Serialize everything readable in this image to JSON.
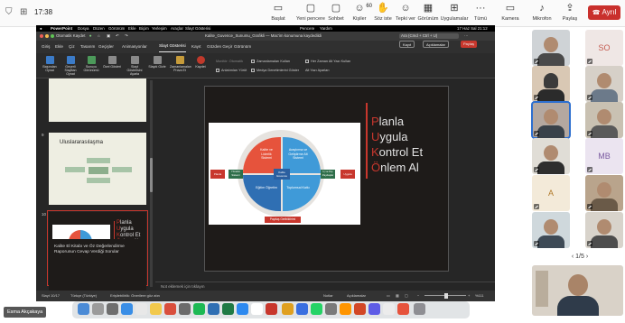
{
  "meeting": {
    "clock": "17:38",
    "toolbar": [
      {
        "label": "Başlat",
        "icon": "video-camera-icon"
      },
      {
        "label": "Yeni pencere",
        "icon": "new-window-icon"
      },
      {
        "label": "Sohbet",
        "icon": "chat-icon"
      },
      {
        "label": "Kişiler",
        "icon": "people-icon",
        "count": "60"
      },
      {
        "label": "Söz iste",
        "icon": "raise-hand-icon"
      },
      {
        "label": "Tepki ver",
        "icon": "react-icon"
      },
      {
        "label": "Görünüm",
        "icon": "view-icon"
      },
      {
        "label": "Uygulamalar",
        "icon": "apps-icon"
      },
      {
        "label": "Tümü",
        "icon": "more-icon"
      },
      {
        "label": "Kamera",
        "icon": "camera-icon"
      },
      {
        "label": "Mikrofon",
        "icon": "microphone-icon"
      },
      {
        "label": "Paylaş",
        "icon": "share-icon"
      }
    ],
    "leave_label": "Ayrıl",
    "pager": "1/5",
    "presenter_name": "Esma Akçakaya",
    "participants": [
      {
        "kind": "video"
      },
      {
        "kind": "initials",
        "initials": "SO"
      },
      {
        "kind": "video"
      },
      {
        "kind": "video"
      },
      {
        "kind": "video",
        "active": true
      },
      {
        "kind": "video"
      },
      {
        "kind": "video"
      },
      {
        "kind": "initials",
        "initials": "MB"
      },
      {
        "kind": "initials",
        "initials": "A"
      },
      {
        "kind": "video"
      },
      {
        "kind": "video"
      },
      {
        "kind": "video"
      }
    ]
  },
  "mac_menu": {
    "app": "PowerPoint",
    "items": [
      "Dosya",
      "Düzen",
      "Görünüm",
      "Ekle",
      "Biçim",
      "Yerleşim",
      "Araçlar",
      "Slayt Gösterisi",
      "Pencere",
      "Yardım"
    ],
    "clock": "17 Haz Sal 21:12"
  },
  "ppt": {
    "autosave": "Otomatik Kaydet",
    "doc_title": "Kalite_Guvence_Sunumu_Grafikli — Mac'im konumuna kaydedildi",
    "search": "Ara (Cmd + Ctrl + U)",
    "tabs": [
      "Giriş",
      "Ekle",
      "Çiz",
      "Tasarım",
      "Geçişler",
      "Animasyonlar",
      "Slayt Gösterisi",
      "Kayıt",
      "Gözden Geçir",
      "Görünüm"
    ],
    "active_tab": "Slayt Gösterisi",
    "btn_record": "Kayıt",
    "btn_comments": "Açıklamalar",
    "btn_share": "Paylaş",
    "ribbon": [
      {
        "label": "Başından Oynat",
        "color": "#3b7bc8"
      },
      {
        "label": "Geçerli Slayttan Oynat",
        "color": "#3b7bc8"
      },
      {
        "label": "Sunucu Görünümü",
        "color": "#4c9a5a"
      },
      {
        "label": "Özel Gösteri",
        "color": "#8a8a8a"
      },
      {
        "label": "Slayt Gösterisini Ayarla",
        "color": "#8a8a8a"
      },
      {
        "label": "Slaydı Gizle",
        "color": "#8a8a8a"
      },
      {
        "label": "Zamanlamaları Prova Et",
        "color": "#c69b3a"
      },
      {
        "label": "Kaydet",
        "color": "#c0392b"
      }
    ],
    "ribbon_options": [
      {
        "label": "Monitör: Otomatik",
        "checked": false
      },
      {
        "label": "Zamanlamaları Kullan",
        "checked": true
      },
      {
        "label": "Anlatımları Yürüt",
        "checked": true
      },
      {
        "label": "Medya Denetimlerini Göster",
        "checked": true
      },
      {
        "label": "Her Zaman Alt Yazı Kullan",
        "checked": false
      },
      {
        "label": "Alt Yazı Ayarları",
        "checked": false
      }
    ],
    "thumbs": [
      {
        "num": "8",
        "text": ""
      },
      {
        "num": "9",
        "text": "Uluslararasılaşma"
      },
      {
        "num": "10",
        "text": ""
      },
      {
        "num": "11",
        "text": "Kalite El Kitabı ve Öz Değerlendirme Raporunun Cevap Verdiği Sorular"
      }
    ],
    "notes_placeholder": "Not eklemek için tıklayın",
    "status": {
      "slide": "Slayt 10/17",
      "language": "Türkçe (Türkiye)",
      "accessibility": "Erişilebilirlik: Önerilere göz atın",
      "notes": "Notlar",
      "comments": "Açıklamalar",
      "zoom": "%111"
    }
  },
  "slide": {
    "acronym": [
      {
        "letter": "P",
        "rest": "lanla"
      },
      {
        "letter": "U",
        "rest": "ygula"
      },
      {
        "letter": "K",
        "rest": "ontrol Et"
      },
      {
        "letter": "Ö",
        "rest": "nlem Al"
      }
    ],
    "quadrants": [
      {
        "text": "Kalite ve Liderlik Sistemi",
        "color": "#e6533c"
      },
      {
        "text": "Araştırma ve Geliştirme Alt Sistemi",
        "color": "#3f9ad8"
      },
      {
        "text": "Eğitim Öğretim",
        "color": "#2f6fb3"
      },
      {
        "text": "Toplumsal Katkı",
        "color": "#3f9ad8"
      }
    ],
    "center": "Kalite Güvence",
    "side_left": "Yönetim Sistemi",
    "side_right": "İç ve Dış Paydaşlar",
    "outer_left": "Planla",
    "outer_right": "Uygula",
    "bottom_tag": "Paydaş Geribildirimi"
  }
}
